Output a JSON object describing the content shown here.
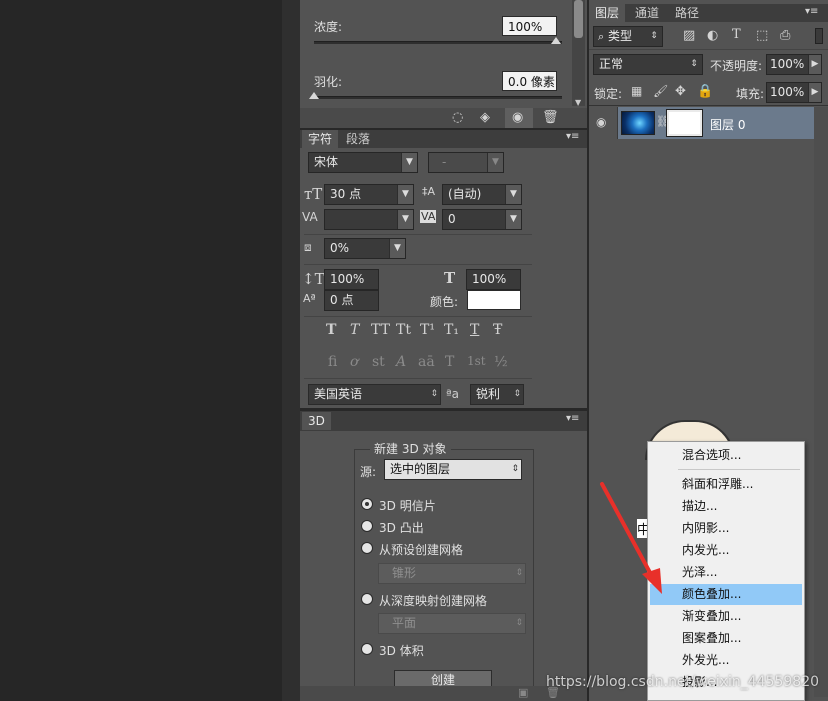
{
  "properties_panel": {
    "density_label": "浓度:",
    "density_value": "100%",
    "feather_label": "羽化:",
    "feather_value": "0.0 像素"
  },
  "character_panel": {
    "tabs": [
      "字符",
      "段落"
    ],
    "font_family": "宋体",
    "font_style": "-",
    "font_size": "30 点",
    "leading": "(自动)",
    "kerning": "",
    "tracking": "0",
    "scale_tsume": "0%",
    "vertical_scale": "100%",
    "horizontal_scale": "100%",
    "baseline_shift": "0 点",
    "color_label": "颜色:",
    "language": "美国英语",
    "antialias_icon_text": "ªa",
    "antialias": "锐利",
    "style_buttons": [
      "T",
      "T",
      "TT",
      "Tt",
      "T¹",
      "T₁",
      "T",
      "Ŧ"
    ],
    "opentype_buttons": [
      "fi",
      "ơ",
      "st",
      "A",
      "aā",
      "T",
      "1st",
      "½"
    ]
  },
  "panel_3d": {
    "tab": "3D",
    "group_title": "新建 3D 对象",
    "source_label": "源:",
    "source_value": "选中的图层",
    "options": [
      "3D 明信片",
      "3D 凸出",
      "从预设创建网格",
      "锥形",
      "从深度映射创建网格",
      "平面",
      "3D 体积"
    ],
    "create_button": "创建"
  },
  "layers_panel": {
    "tabs": [
      "图层",
      "通道",
      "路径"
    ],
    "filter_kind": "类型",
    "filter_search_glyph": "⌕",
    "blend_mode": "正常",
    "opacity_label": "不透明度:",
    "opacity_value": "100%",
    "lock_label": "锁定:",
    "fill_label": "填充:",
    "fill_value": "100%",
    "layer_name": "图层 0"
  },
  "context_menu": {
    "items": [
      "混合选项...",
      "斜面和浮雕...",
      "描边...",
      "内阴影...",
      "内发光...",
      "光泽...",
      "颜色叠加...",
      "渐变叠加...",
      "图案叠加...",
      "外发光...",
      "投影..."
    ],
    "highlighted_index": 6
  },
  "overlay": {
    "watermark": "https://blog.csdn.net/weixin_44559820",
    "canvas_partial_text": "中"
  },
  "colors": {
    "panel_bg": "#535353",
    "menu_highlight": "#91c9f7",
    "arrow": "#e8302a"
  }
}
